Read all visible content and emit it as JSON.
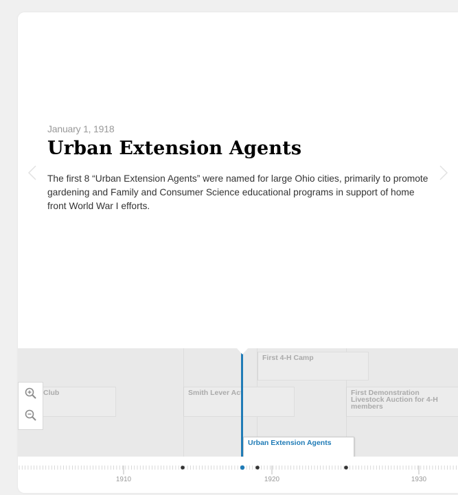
{
  "slide": {
    "date": "January 1, 1918",
    "title": "Urban Extension Agents",
    "text": "The first 8 “Urban Extension Agents” were named for large Ohio cities, primarily to promote gardening and Family and Consumer Science educational programs in support of home front World War I efforts."
  },
  "timeline": {
    "events": [
      {
        "label": "First 4-H Camp"
      },
      {
        "label": "Club"
      },
      {
        "label": "Smith Lever Act"
      },
      {
        "label": "First Demonstration Livestock Auction for 4-H members"
      },
      {
        "label": "Urban Extension Agents",
        "active": true
      }
    ],
    "axis_labels": [
      "1910",
      "1920",
      "1930"
    ],
    "accent": "#1f7bb6"
  },
  "icons": {
    "prev": "chevron-left-icon",
    "next": "chevron-right-icon",
    "zoom_in": "zoom-in-icon",
    "zoom_out": "zoom-out-icon"
  }
}
